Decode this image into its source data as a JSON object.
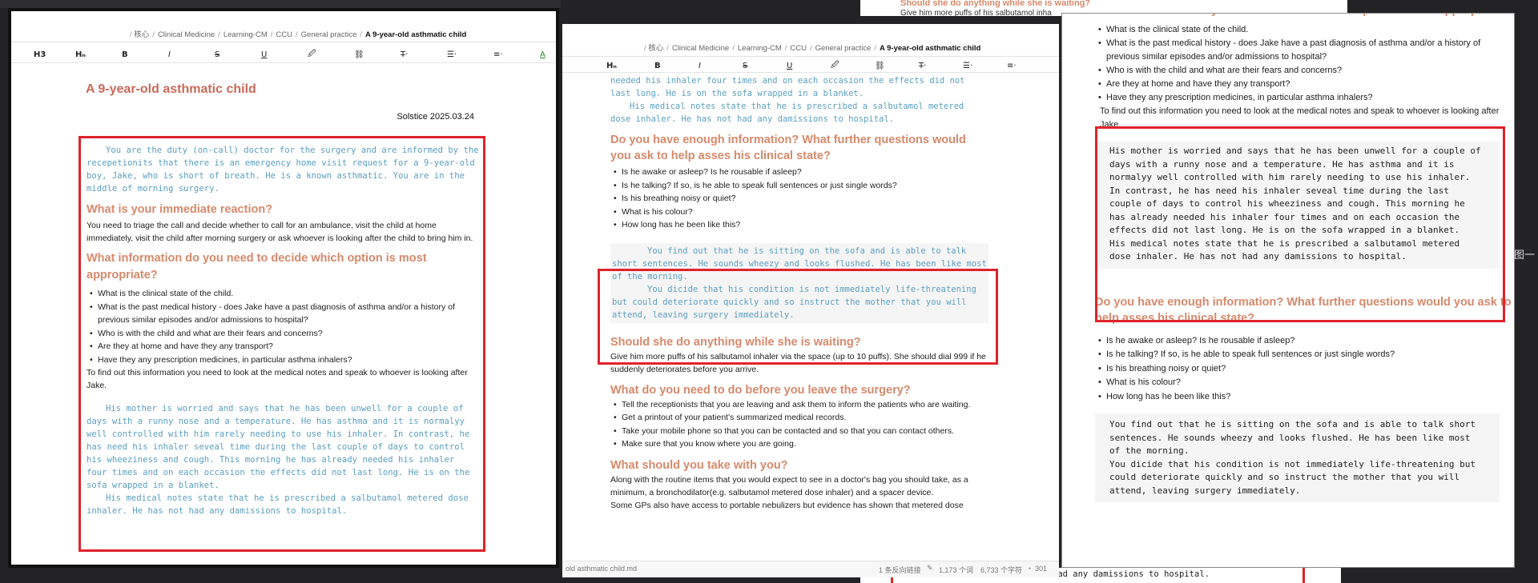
{
  "doc": {
    "title": "A 9-year-old asthmatic child",
    "author_date": "Solstice 2025.03.24",
    "filename": "old asthmatic child.md"
  },
  "breadcrumb": [
    "核心",
    "Clinical Medicine",
    "Learning-CM",
    "CCU",
    "General practice",
    "A 9-year-old asthmatic child"
  ],
  "toolbar": {
    "h3": "H3",
    "hn": "Hₙ",
    "bold": "B",
    "italic": "I",
    "strike": "S",
    "underline": "U",
    "highlight": "🖉",
    "link": "⛓",
    "more": "T̶·",
    "list": "☰·",
    "align": "≡·",
    "color": "A"
  },
  "content": {
    "intro": "You are the duty (on-call) doctor for the surgery and are informed by the recepetionits that there is an emergency home visit request for a 9-year-old boy, Jake, who is short of breath. He is a known asthmatic. You are in the middle of morning surgery.",
    "h_reaction": "What is your immediate reaction?",
    "reaction": "You need to triage the call and decide whether to call for an ambulance, visit the child at home immediately, visit the child after morning surgery or ask whoever is looking after the child to bring him in.",
    "h_info": "What information do you need to decide which option is most appropriate?",
    "info_items": [
      "What is the clinical state of the child.",
      "What is the past medical history - does Jake have a past diagnosis of asthma and/or a history of previous similar episodes and/or admissions to hospital?",
      "Who is with the child and what are their fears and concerns?",
      "Are they at home and have they any transport?",
      "Have they any prescription medicines, in particular asthma inhalers?"
    ],
    "find_out": "To find out this information you need to look at the medical notes and speak to whoever is looking after Jake.",
    "mother": "His mother is worried and says that he has been unwell for a couple of days with a runny nose and a temperature. He has asthma and it is normalyy well controlled with him rarely needing to use his inhaler. In contrast, he has need his inhaler seveal time during the last couple of days to control his wheeziness and cough. This morning he has already needed his inhaler four times and on each occasion the effects did not last long. He is on the sofa wrapped in a blanket.",
    "notes": "His medical notes state that he is prescribed a salbutamol metered dose inhaler. He has not had any damissions to hospital.",
    "h_enough": "Do you have enough information? What further questions would you ask to help asses his clinical state?",
    "enough_items": [
      "Is he awake or asleep? Is he rousable if asleep?",
      "Is he talking? If so, is he able to speak full sentences or just single words?",
      "Is his breathing noisy or quiet?",
      "What is his colour?",
      "How long has he been like this?"
    ],
    "sofa": "You find out that he is sitting on the sofa and is able to talk short sentences. He sounds wheezy and looks flushed. He has been like most of the morning.",
    "decide": "You dicide that his condition is not immediately life-threatening but could deteriorate quickly and so instruct the mother that you will attend, leaving surgery immediately.",
    "h_waiting": "Should she do anything while she is waiting?",
    "waiting": "Give him more puffs of his salbutamol inhaler via the space (up to 10 puffs). She should dial 999 if he suddenly deteriorates before you arrive.",
    "h_before": "What do you need to do before you leave the surgery?",
    "before_items": [
      "Tell the receptionists that you are leaving and ask them to inform the patients who are waiting.",
      "Get a printout of your patient's summarized medical records.",
      "Take your mobile phone so that you can be contacted and so that you can contact others.",
      "Make sure that you know where you are going."
    ],
    "h_take": "What should you take with you?",
    "take": "Along with the routine items that you would expect to see in a doctor's bag you should take, as a minimum, a bronchodilator(e.g. salbutamol metered dose inhaler) and a spacer device.",
    "take2": "Some GPs also have access to portable nebulizers but evidence has shown that metered dose"
  },
  "statusbar": {
    "backlinks": "1 条反向链接",
    "words": "1,173 个词",
    "chars": "6,733 个字符",
    "count": "301"
  },
  "bg_fragments": {
    "top_waiting": "Should she do anything while she is waiting?",
    "top_line": "Give him more puffs of his salbutamol inha",
    "top_999": "999 if he suddenly deteriorates before",
    "bottom_notes": "had any damissions to hospital.",
    "edge_label": "图一"
  },
  "colors": {
    "highlight_box": "#e0232b",
    "heading": "#d7896b",
    "code": "#5a9fc0"
  }
}
